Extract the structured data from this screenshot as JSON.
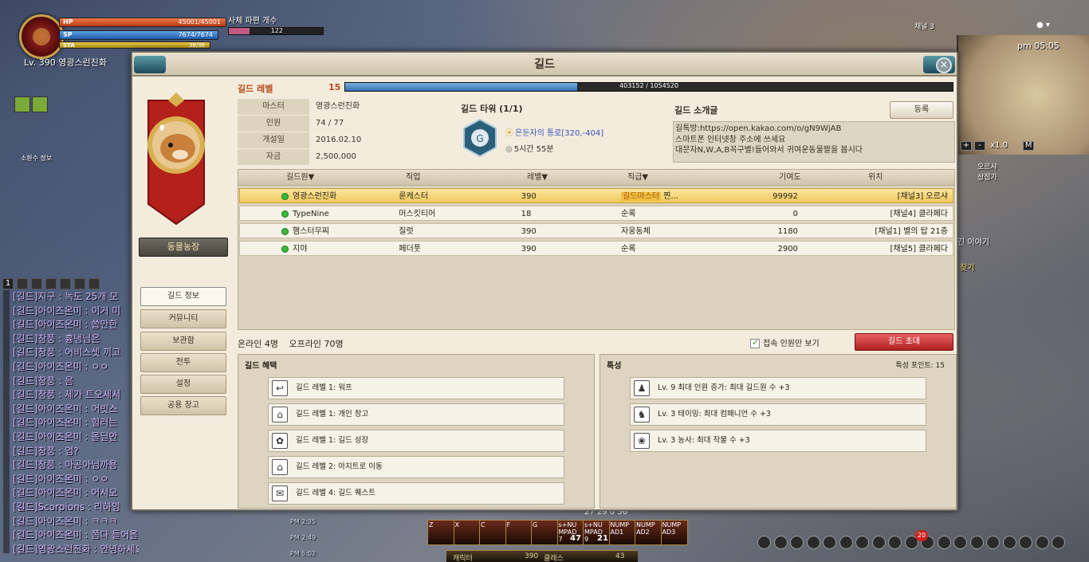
{
  "hud": {
    "hp_label": "HP",
    "hp_value": "45001/45001",
    "sp_label": "SP",
    "sp_value": "7674/7674",
    "sta_label": "STA",
    "sta_value": "38/38",
    "level_name": "Lv. 390  영광스런진화",
    "soul_label": "사체 파편 개수",
    "soul_value": "122",
    "summon_info": "소환수 정보"
  },
  "minimap": {
    "channel": "채널 3",
    "time": "pm 05:05",
    "zoom": "x1.0",
    "zoom_plus": "+",
    "zoom_minus": "-",
    "mode": "M",
    "label_1": "오르샤",
    "label_2": "상점가",
    "story_hint": "긴 이야기",
    "quest_hint": "찾기"
  },
  "chat": {
    "tab": "1",
    "lines": [
      "[길드]지구 : 녹도 25개 모",
      "[길드]아이즈온미 : 이거 미",
      "[길드]아이즈온미 : 씁만한",
      "[길드]창풍 : 흉냉님은",
      "[길드]창풍 : 어비스셋 끼고",
      "[길드]아이즈온미 : ㅇㅇ",
      "[길드]창풍 : 음",
      "[길드]창풍 : 제가 트오세서",
      "[길드]아이즈온미 : 어빗스",
      "[길드]아이즈온미 : 힐러는",
      "[길드]아이즈온미 : 몰딜안",
      "[길드]창풍 : 엄?",
      "[길드]창풍 : 마공아님까용",
      "[길드]아이즈온미 : ㅇㅇ",
      "[길드]아이즈온미 : 어서오",
      "[길드]Scorpions : 리하잉",
      "[길드]아이즈온미 : ㅋㅋㅋ",
      "[길드]아이즈온미 : 쫌다 들어올께용",
      "[길드]영광스런진화 : 안녕하세요~"
    ],
    "stamps": [
      "PM 2:35",
      "PM 2:49",
      "PM 5:02"
    ]
  },
  "skillbar": {
    "slots": [
      "Z",
      "X",
      "C",
      "F",
      "G",
      "s+NU MPAD 7",
      "s+NU MPAD 9",
      "NUMP AD1",
      "NUMP AD2",
      "NUMP AD3"
    ],
    "counts": [
      "47",
      "21"
    ],
    "top_nums": "27   29   0   56",
    "bottom_left": "캐릭터",
    "bottom_mid": "390",
    "bottom_class": "클래스",
    "bottom_right": "43",
    "notif": "20"
  },
  "window": {
    "title": "길드",
    "close": "×",
    "guild_name": "동물농장",
    "nav": [
      "길드 정보",
      "커뮤니티",
      "보관함",
      "전투",
      "설정",
      "공용 창고"
    ],
    "level_label": "길드 레벨",
    "level": "15",
    "exp_text": "403152 / 1054520",
    "exp_fraction": 0.382,
    "info": [
      {
        "k": "마스터",
        "v": "영광스런진화"
      },
      {
        "k": "인원",
        "v": "74 / 77"
      },
      {
        "k": "개설일",
        "v": "2016.02.10"
      },
      {
        "k": "자금",
        "v": "2,500,000"
      }
    ],
    "tower_title": "길드 타워 (1/1)",
    "tower_location": "은둔자의 통로[320,-404]",
    "tower_time": "5시간 55분",
    "intro_title": "길드 소개글",
    "register": "등록",
    "intro_lines": [
      "길톡방:https://open.kakao.com/o/gN9WjAB",
      "스마트폰 인터넷창 주소에 쓰세요",
      "대문자N,W,A,B꼭구별!들어와서 귀여운동물짤을 봅시다"
    ],
    "columns": [
      "길드원▼",
      "직업",
      "레벨▼",
      "직급▼",
      "기여도",
      "위치"
    ],
    "members": [
      {
        "name": "영광스런진화",
        "job": "룬캐스터",
        "level": "390",
        "rank": "길드마스터",
        "rank_suffix": " 찐...",
        "contrib": "99992",
        "loc": "[채널3] 오르샤",
        "highlight": true
      },
      {
        "name": "TypeNine",
        "job": "머스킷티어",
        "level": "18",
        "rank": "순록",
        "rank_suffix": "",
        "contrib": "0",
        "loc": "[채널4] 클라페다",
        "highlight": false
      },
      {
        "name": "햄스터무찌",
        "job": "질럿",
        "level": "390",
        "rank": "자웅동체",
        "rank_suffix": "",
        "contrib": "1180",
        "loc": "[채널1] 별의 탑 21층",
        "highlight": false
      },
      {
        "name": "지야",
        "job": "페더풋",
        "level": "390",
        "rank": "순록",
        "rank_suffix": "",
        "contrib": "2900",
        "loc": "[채널5] 클라페다",
        "highlight": false
      }
    ],
    "online": "온라인 4명",
    "offline": "오프라인 70명",
    "online_only": "접속 인원만 보기",
    "invite": "길드 초대",
    "benefits_title": "길드 혜택",
    "benefits": [
      {
        "icon": "↩",
        "label": "길드 레벨 1: 워프"
      },
      {
        "icon": "⌂",
        "label": "길드 레벨 1: 개인 창고"
      },
      {
        "icon": "✿",
        "label": "길드 레벨 1: 길드 성장"
      },
      {
        "icon": "⌂",
        "label": "길드 레벨 2: 아지트로 이동"
      },
      {
        "icon": "✉",
        "label": "길드 레벨 4: 길드 퀘스트"
      }
    ],
    "traits_title": "특성",
    "traits_points": "특성 포인트: 15",
    "traits": [
      {
        "icon": "♟",
        "label": "Lv. 9 최대 인원 증가: 최대 길드원 수 +3"
      },
      {
        "icon": "♞",
        "label": "Lv. 3 테이밍: 최대 컴패니언 수 +3"
      },
      {
        "icon": "❀",
        "label": "Lv. 3 농사: 최대 작물 수 +3"
      }
    ]
  }
}
